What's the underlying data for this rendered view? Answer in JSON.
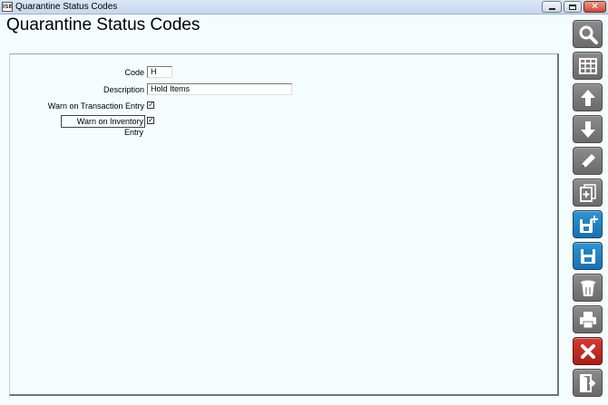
{
  "window": {
    "title": "Quarantine Status Codes",
    "app_icon_text": "ISE"
  },
  "page": {
    "title": "Quarantine Status Codes"
  },
  "form": {
    "code_label": "Code",
    "code_value": "H",
    "description_label": "Description",
    "description_value": "Hold Items",
    "warn_transaction_label": "Warn on Transaction Entry",
    "warn_transaction_checked": true,
    "warn_inventory_label": "Warn on Inventory Entry",
    "warn_inventory_checked": true,
    "check_glyph": "✓"
  },
  "toolbar": {
    "buttons": [
      {
        "icon": "search-icon",
        "color": "#7a7a7a"
      },
      {
        "icon": "grid-icon",
        "color": "#7a7a7a"
      },
      {
        "icon": "arrow-up-icon",
        "color": "#7a7a7a"
      },
      {
        "icon": "arrow-down-icon",
        "color": "#7a7a7a"
      },
      {
        "icon": "pencil-icon",
        "color": "#7a7a7a"
      },
      {
        "icon": "new-document-icon",
        "color": "#7a7a7a"
      },
      {
        "icon": "save-new-icon",
        "color": "#2482c0"
      },
      {
        "icon": "save-icon",
        "color": "#2482c0"
      },
      {
        "icon": "trash-icon",
        "color": "#7a7a7a"
      },
      {
        "icon": "print-icon",
        "color": "#7a7a7a"
      },
      {
        "icon": "cancel-icon",
        "color": "#c22c26"
      },
      {
        "icon": "exit-icon",
        "color": "#7a7a7a"
      }
    ]
  }
}
